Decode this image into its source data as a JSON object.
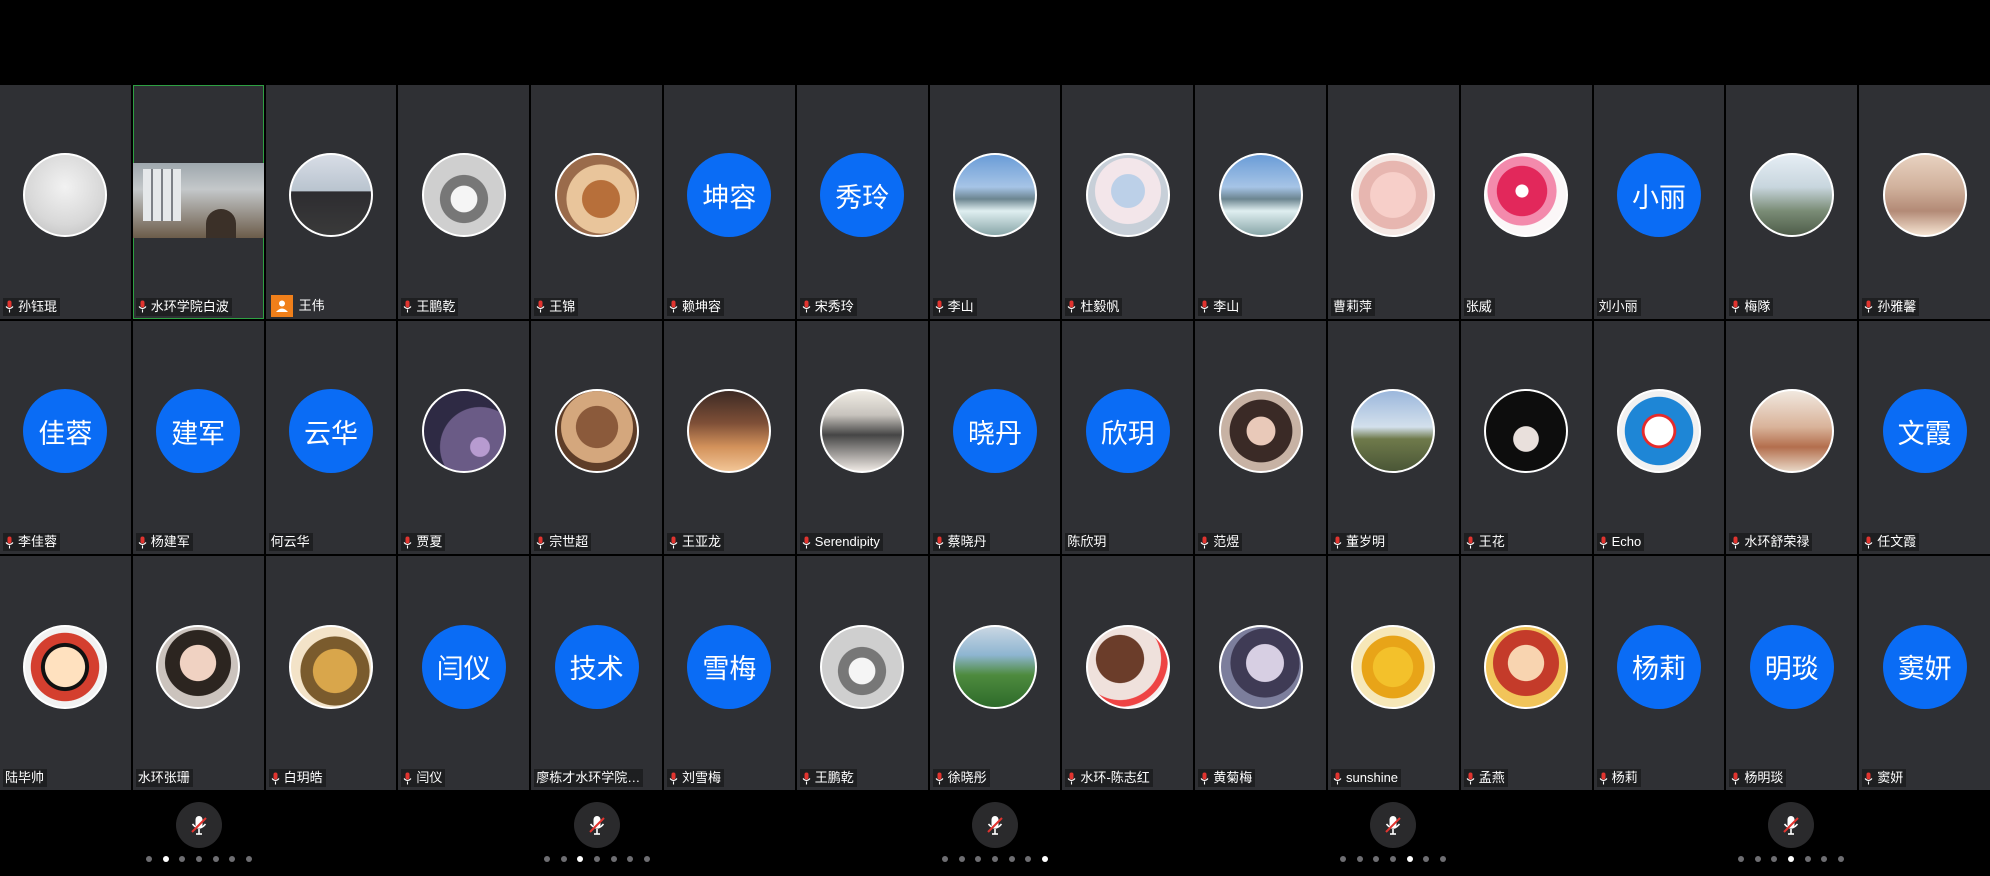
{
  "participants": [
    {
      "name": "孙钰琨",
      "mic": true,
      "avatar": "photo",
      "photo": "p1"
    },
    {
      "name": "水环学院白波",
      "mic": true,
      "avatar": "video",
      "active": true
    },
    {
      "name": "王伟",
      "host": true,
      "avatar": "photo",
      "photo": "p2"
    },
    {
      "name": "王鹏乾",
      "mic": true,
      "avatar": "photo",
      "photo": "p3"
    },
    {
      "name": "王锦",
      "mic": true,
      "avatar": "photo",
      "photo": "p4"
    },
    {
      "name": "赖坤容",
      "mic": true,
      "avatar": "initials",
      "initials": "坤容"
    },
    {
      "name": "宋秀玲",
      "mic": true,
      "avatar": "initials",
      "initials": "秀玲"
    },
    {
      "name": "李山",
      "mic": true,
      "avatar": "photo",
      "photo": "p5"
    },
    {
      "name": "杜毅帆",
      "mic": true,
      "avatar": "photo",
      "photo": "p6"
    },
    {
      "name": "李山",
      "mic": true,
      "avatar": "photo",
      "photo": "p5"
    },
    {
      "name": "曹莉萍",
      "mic": false,
      "avatar": "photo",
      "photo": "p7"
    },
    {
      "name": "张威",
      "mic": false,
      "avatar": "photo",
      "photo": "p8"
    },
    {
      "name": "刘小丽",
      "mic": false,
      "avatar": "initials",
      "initials": "小丽"
    },
    {
      "name": "梅隊",
      "mic": true,
      "avatar": "photo",
      "photo": "p9"
    },
    {
      "name": "孙雅馨",
      "mic": true,
      "avatar": "photo",
      "photo": "p10"
    },
    {
      "name": "李佳蓉",
      "mic": true,
      "avatar": "initials",
      "initials": "佳蓉"
    },
    {
      "name": "杨建军",
      "mic": true,
      "avatar": "initials",
      "initials": "建军"
    },
    {
      "name": "何云华",
      "mic": false,
      "avatar": "initials",
      "initials": "云华"
    },
    {
      "name": "贾夏",
      "mic": true,
      "avatar": "photo",
      "photo": "p11"
    },
    {
      "name": "宗世超",
      "mic": true,
      "avatar": "photo",
      "photo": "p12"
    },
    {
      "name": "王亚龙",
      "mic": true,
      "avatar": "photo",
      "photo": "p13"
    },
    {
      "name": "Serendipity",
      "mic": true,
      "avatar": "photo",
      "photo": "p14"
    },
    {
      "name": "蔡晓丹",
      "mic": true,
      "avatar": "initials",
      "initials": "晓丹"
    },
    {
      "name": "陈欣玥",
      "mic": false,
      "avatar": "initials",
      "initials": "欣玥"
    },
    {
      "name": "范煜",
      "mic": true,
      "avatar": "photo",
      "photo": "p15"
    },
    {
      "name": "董岁明",
      "mic": true,
      "avatar": "photo",
      "photo": "p16"
    },
    {
      "name": "王花",
      "mic": true,
      "avatar": "photo",
      "photo": "p17"
    },
    {
      "name": "Echo",
      "mic": true,
      "avatar": "photo",
      "photo": "p18"
    },
    {
      "name": "水环舒荣禄",
      "mic": true,
      "avatar": "photo",
      "photo": "p19"
    },
    {
      "name": "任文霞",
      "mic": true,
      "avatar": "initials",
      "initials": "文霞"
    },
    {
      "name": "陆毕帅",
      "mic": false,
      "avatar": "photo",
      "photo": "p20"
    },
    {
      "name": "水环张珊",
      "mic": false,
      "avatar": "photo",
      "photo": "p21"
    },
    {
      "name": "白玥皓",
      "mic": true,
      "avatar": "photo",
      "photo": "p22"
    },
    {
      "name": "闫仪",
      "mic": true,
      "avatar": "initials",
      "initials": "闫仪"
    },
    {
      "name": "廖栋才水环学院…",
      "mic": false,
      "avatar": "initials",
      "initials": "技术"
    },
    {
      "name": "刘雪梅",
      "mic": true,
      "avatar": "initials",
      "initials": "雪梅"
    },
    {
      "name": "王鹏乾",
      "mic": true,
      "avatar": "photo",
      "photo": "p3"
    },
    {
      "name": "徐晓彤",
      "mic": true,
      "avatar": "photo",
      "photo": "p23"
    },
    {
      "name": "水环-陈志红",
      "mic": true,
      "avatar": "photo",
      "photo": "p24"
    },
    {
      "name": "黄菊梅",
      "mic": true,
      "avatar": "photo",
      "photo": "p25"
    },
    {
      "name": "sunshine",
      "mic": true,
      "avatar": "photo",
      "photo": "p26"
    },
    {
      "name": "孟燕",
      "mic": true,
      "avatar": "photo",
      "photo": "p27"
    },
    {
      "name": "杨莉",
      "mic": true,
      "avatar": "initials",
      "initials": "杨莉"
    },
    {
      "name": "杨明琰",
      "mic": true,
      "avatar": "initials",
      "initials": "明琰"
    },
    {
      "name": "窦妍",
      "mic": true,
      "avatar": "initials",
      "initials": "窦妍"
    }
  ],
  "pages": [
    {
      "active_dot": 1
    },
    {
      "active_dot": 2
    },
    {
      "active_dot": 6
    },
    {
      "active_dot": 4
    },
    {
      "active_dot": 3
    }
  ],
  "dots_per_page": 7,
  "colors": {
    "tile_bg": "#2f3034",
    "initials_bg": "#0a6cf5",
    "mic_red": "#e1342f",
    "host_badge": "#f07f1a"
  },
  "icons": {
    "mic": "mic-icon",
    "host": "host-avatar-icon",
    "muted_mic_button": "mic-muted-icon"
  }
}
